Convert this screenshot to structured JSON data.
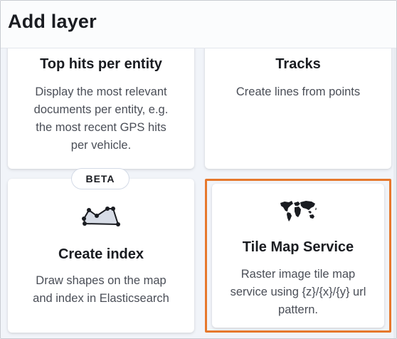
{
  "header": {
    "title": "Add layer"
  },
  "badges": {
    "beta": "BETA"
  },
  "cards": [
    {
      "title": "Top hits per entity",
      "desc_lines": [
        "Display the most relevant",
        "documents per entity, e.g.",
        "the most recent GPS hits",
        "per vehicle."
      ]
    },
    {
      "title": "Tracks",
      "desc_lines": [
        "Create lines from points"
      ]
    },
    {
      "title": "Create index",
      "icon": "draw-polygon-icon",
      "desc_lines": [
        "Draw shapes on the map",
        "and index in Elasticsearch"
      ]
    },
    {
      "title": "Tile Map Service",
      "icon": "world-map-icon",
      "desc_lines": [
        "Raster image tile map",
        "service using {z}/{x}/{y} url",
        "pattern."
      ]
    }
  ],
  "colors": {
    "highlight_border": "#e6782c",
    "title_text": "#1a1c21",
    "desc_text": "#4a4e57"
  }
}
